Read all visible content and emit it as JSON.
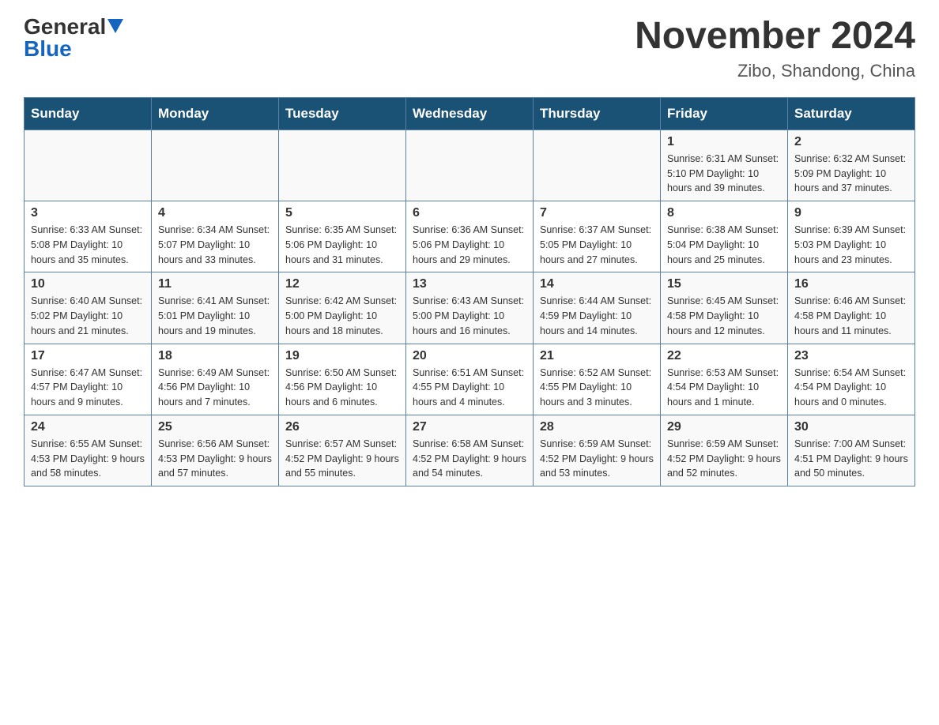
{
  "header": {
    "logo_general": "General",
    "logo_blue": "Blue",
    "month_title": "November 2024",
    "location": "Zibo, Shandong, China"
  },
  "days_of_week": [
    "Sunday",
    "Monday",
    "Tuesday",
    "Wednesday",
    "Thursday",
    "Friday",
    "Saturday"
  ],
  "weeks": [
    [
      {
        "day": "",
        "info": ""
      },
      {
        "day": "",
        "info": ""
      },
      {
        "day": "",
        "info": ""
      },
      {
        "day": "",
        "info": ""
      },
      {
        "day": "",
        "info": ""
      },
      {
        "day": "1",
        "info": "Sunrise: 6:31 AM\nSunset: 5:10 PM\nDaylight: 10 hours and 39 minutes."
      },
      {
        "day": "2",
        "info": "Sunrise: 6:32 AM\nSunset: 5:09 PM\nDaylight: 10 hours and 37 minutes."
      }
    ],
    [
      {
        "day": "3",
        "info": "Sunrise: 6:33 AM\nSunset: 5:08 PM\nDaylight: 10 hours and 35 minutes."
      },
      {
        "day": "4",
        "info": "Sunrise: 6:34 AM\nSunset: 5:07 PM\nDaylight: 10 hours and 33 minutes."
      },
      {
        "day": "5",
        "info": "Sunrise: 6:35 AM\nSunset: 5:06 PM\nDaylight: 10 hours and 31 minutes."
      },
      {
        "day": "6",
        "info": "Sunrise: 6:36 AM\nSunset: 5:06 PM\nDaylight: 10 hours and 29 minutes."
      },
      {
        "day": "7",
        "info": "Sunrise: 6:37 AM\nSunset: 5:05 PM\nDaylight: 10 hours and 27 minutes."
      },
      {
        "day": "8",
        "info": "Sunrise: 6:38 AM\nSunset: 5:04 PM\nDaylight: 10 hours and 25 minutes."
      },
      {
        "day": "9",
        "info": "Sunrise: 6:39 AM\nSunset: 5:03 PM\nDaylight: 10 hours and 23 minutes."
      }
    ],
    [
      {
        "day": "10",
        "info": "Sunrise: 6:40 AM\nSunset: 5:02 PM\nDaylight: 10 hours and 21 minutes."
      },
      {
        "day": "11",
        "info": "Sunrise: 6:41 AM\nSunset: 5:01 PM\nDaylight: 10 hours and 19 minutes."
      },
      {
        "day": "12",
        "info": "Sunrise: 6:42 AM\nSunset: 5:00 PM\nDaylight: 10 hours and 18 minutes."
      },
      {
        "day": "13",
        "info": "Sunrise: 6:43 AM\nSunset: 5:00 PM\nDaylight: 10 hours and 16 minutes."
      },
      {
        "day": "14",
        "info": "Sunrise: 6:44 AM\nSunset: 4:59 PM\nDaylight: 10 hours and 14 minutes."
      },
      {
        "day": "15",
        "info": "Sunrise: 6:45 AM\nSunset: 4:58 PM\nDaylight: 10 hours and 12 minutes."
      },
      {
        "day": "16",
        "info": "Sunrise: 6:46 AM\nSunset: 4:58 PM\nDaylight: 10 hours and 11 minutes."
      }
    ],
    [
      {
        "day": "17",
        "info": "Sunrise: 6:47 AM\nSunset: 4:57 PM\nDaylight: 10 hours and 9 minutes."
      },
      {
        "day": "18",
        "info": "Sunrise: 6:49 AM\nSunset: 4:56 PM\nDaylight: 10 hours and 7 minutes."
      },
      {
        "day": "19",
        "info": "Sunrise: 6:50 AM\nSunset: 4:56 PM\nDaylight: 10 hours and 6 minutes."
      },
      {
        "day": "20",
        "info": "Sunrise: 6:51 AM\nSunset: 4:55 PM\nDaylight: 10 hours and 4 minutes."
      },
      {
        "day": "21",
        "info": "Sunrise: 6:52 AM\nSunset: 4:55 PM\nDaylight: 10 hours and 3 minutes."
      },
      {
        "day": "22",
        "info": "Sunrise: 6:53 AM\nSunset: 4:54 PM\nDaylight: 10 hours and 1 minute."
      },
      {
        "day": "23",
        "info": "Sunrise: 6:54 AM\nSunset: 4:54 PM\nDaylight: 10 hours and 0 minutes."
      }
    ],
    [
      {
        "day": "24",
        "info": "Sunrise: 6:55 AM\nSunset: 4:53 PM\nDaylight: 9 hours and 58 minutes."
      },
      {
        "day": "25",
        "info": "Sunrise: 6:56 AM\nSunset: 4:53 PM\nDaylight: 9 hours and 57 minutes."
      },
      {
        "day": "26",
        "info": "Sunrise: 6:57 AM\nSunset: 4:52 PM\nDaylight: 9 hours and 55 minutes."
      },
      {
        "day": "27",
        "info": "Sunrise: 6:58 AM\nSunset: 4:52 PM\nDaylight: 9 hours and 54 minutes."
      },
      {
        "day": "28",
        "info": "Sunrise: 6:59 AM\nSunset: 4:52 PM\nDaylight: 9 hours and 53 minutes."
      },
      {
        "day": "29",
        "info": "Sunrise: 6:59 AM\nSunset: 4:52 PM\nDaylight: 9 hours and 52 minutes."
      },
      {
        "day": "30",
        "info": "Sunrise: 7:00 AM\nSunset: 4:51 PM\nDaylight: 9 hours and 50 minutes."
      }
    ]
  ]
}
